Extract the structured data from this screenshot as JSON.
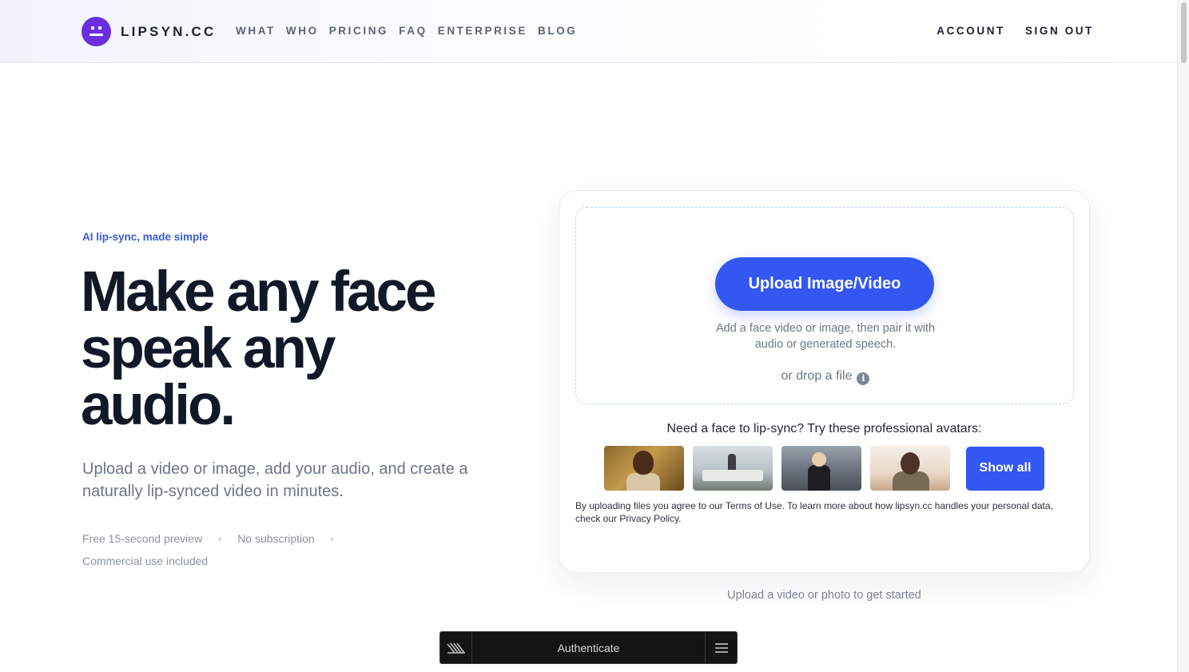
{
  "header": {
    "logo_text": "LIPSYN.CC",
    "nav": [
      "WHAT",
      "WHO",
      "PRICING",
      "FAQ",
      "ENTERPRISE",
      "BLOG"
    ],
    "account_label": "ACCOUNT",
    "signout_label": "SIGN OUT"
  },
  "hero": {
    "eyebrow": "AI lip-sync, made simple",
    "headline_lines": [
      "Make any face",
      "speak any",
      "audio."
    ],
    "subtext": "Upload a video or image, add your audio, and create a naturally lip-synced video in minutes.",
    "features": [
      "Free 15-second preview",
      "No subscription",
      "Commercial use included"
    ]
  },
  "uploader": {
    "button_label": "Upload Image/Video",
    "hint_lines": [
      "Add a face video or image, then pair it with",
      "audio or generated speech."
    ],
    "drop_label": "or drop a file",
    "info_icon": "info-icon",
    "avatars_title": "Need a face to lip-sync? Try these professional avatars:",
    "avatars": [
      "avatar-woman-yellow-background",
      "avatar-meeting-room",
      "avatar-woman-street",
      "avatar-older-man"
    ],
    "show_all_label": "Show all",
    "legal_text": "By uploading files you agree to our Terms of Use. To learn more about how lipsyn.cc handles your personal data, check our Privacy Policy.",
    "below_card_text": "Upload a video or photo to get started"
  },
  "authbar": {
    "label": "Authenticate",
    "logo_icon": "stripes-logo-icon",
    "menu_icon": "hamburger-menu-icon"
  },
  "colors": {
    "brand_purple": "#6b2fe0",
    "accent_blue": "#3457f2",
    "eyebrow_blue": "#3b5bdb",
    "headline": "#111827"
  }
}
